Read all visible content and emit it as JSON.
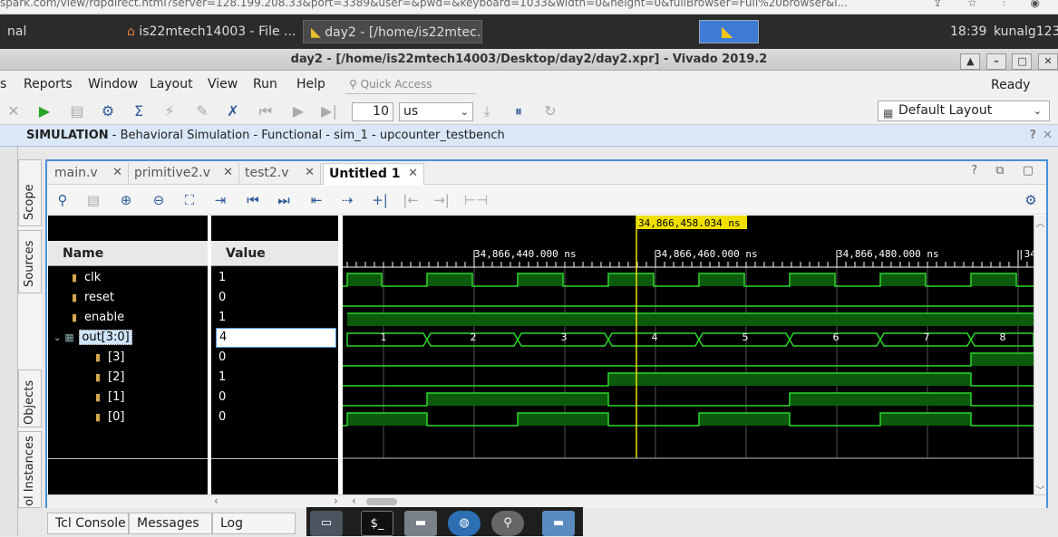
{
  "browser": {
    "url": "spark.com/view/rdpdirect.html?server=128.199.208.33&port=3389&user=&pwd=&keyboard=1033&width=0&height=0&fullBrowser=Full%20browser&i..."
  },
  "taskbar": {
    "terminal_label": "nal",
    "files_label": "is22mtech14003 - File ...",
    "vivado_label": "day2 - [/home/is22mtec...",
    "clock": "18:39",
    "user": "kunalg123"
  },
  "window": {
    "title": "day2 - [/home/is22mtech14003/Desktop/day2/day2.xpr] - Vivado 2019.2"
  },
  "menu": {
    "items": [
      "s",
      "Reports",
      "Window",
      "Layout",
      "View",
      "Run",
      "Help"
    ],
    "quick_access_placeholder": "Quick Access",
    "status": "Ready"
  },
  "toolbar": {
    "time_value": "10",
    "time_unit": "us",
    "layout": "Default Layout"
  },
  "simulation_banner": {
    "prefix": "SIMULATION",
    "detail": " - Behavioral Simulation - Functional - sim_1 - upcounter_testbench"
  },
  "side_tabs": [
    "Scope",
    "Sources",
    "Objects",
    "ol Instances"
  ],
  "doc_tabs": [
    {
      "label": "main.v",
      "active": false
    },
    {
      "label": "primitive2.v",
      "active": false
    },
    {
      "label": "test2.v",
      "active": false
    },
    {
      "label": "Untitled 1",
      "active": true
    }
  ],
  "columns": {
    "name": "Name",
    "value": "Value"
  },
  "signals": [
    {
      "name": "clk",
      "value": "1",
      "type": "bit"
    },
    {
      "name": "reset",
      "value": "0",
      "type": "bit"
    },
    {
      "name": "enable",
      "value": "1",
      "type": "bit"
    },
    {
      "name": "out[3:0]",
      "value": "4",
      "type": "bus",
      "selected": true
    },
    {
      "name": "[3]",
      "value": "0",
      "type": "bit"
    },
    {
      "name": "[2]",
      "value": "1",
      "type": "bit"
    },
    {
      "name": "[1]",
      "value": "0",
      "type": "bit"
    },
    {
      "name": "[0]",
      "value": "0",
      "type": "bit"
    }
  ],
  "waveform": {
    "cursor_label": "34,866,458.034 ns",
    "time_labels": [
      "34,866,440.000 ns",
      "34,866,460.000 ns",
      "34,866,480.000 ns",
      "|34,"
    ],
    "bus_values": [
      "1",
      "2",
      "3",
      "4",
      "5",
      "6",
      "7",
      "8"
    ],
    "colors": {
      "background": "#000000",
      "wave": "#2bd52b",
      "fill": "#0c5a0c",
      "cursor": "#f0e000"
    }
  },
  "bottom_tabs": [
    "Tcl Console",
    "Messages",
    "Log"
  ],
  "dock": {
    "terminal_label": "$_"
  }
}
